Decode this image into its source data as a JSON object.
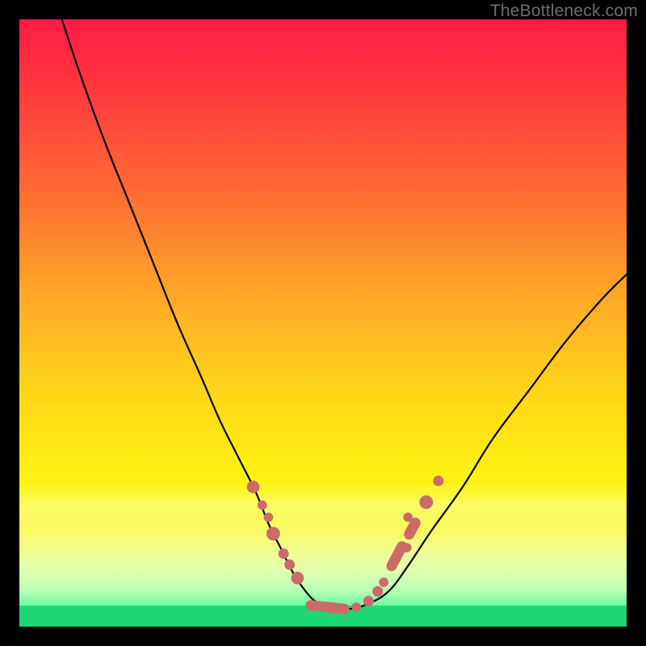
{
  "attribution": "TheBottleneck.com",
  "colors": {
    "gradient_top": "#ff1b46",
    "gradient_bottom": "#1bd873",
    "curve": "#000000",
    "marker": "#cc6a6a",
    "frame": "#000000"
  },
  "chart_data": {
    "type": "line",
    "title": "",
    "xlabel": "",
    "ylabel": "",
    "xlim": [
      0,
      100
    ],
    "ylim": [
      0,
      100
    ],
    "grid": false,
    "legend": false,
    "series": [
      {
        "name": "bottleneck-curve",
        "x": [
          7,
          10,
          14,
          18,
          22,
          26,
          30,
          33,
          36,
          39,
          41,
          43,
          45,
          47,
          49,
          52,
          55,
          58,
          61,
          64,
          68,
          73,
          78,
          84,
          90,
          96,
          100
        ],
        "y": [
          100,
          91,
          80,
          70,
          60,
          50,
          41,
          34,
          28,
          22,
          17,
          13,
          9,
          6,
          4,
          3,
          3,
          4,
          6,
          10,
          16,
          23,
          31,
          39,
          47,
          54,
          58
        ]
      }
    ],
    "markers": [
      {
        "x": 38.5,
        "y": 23.0,
        "r": 1.2
      },
      {
        "x": 40.0,
        "y": 20.0,
        "r": 0.9
      },
      {
        "x": 41.0,
        "y": 18.0,
        "r": 0.9
      },
      {
        "x": 41.8,
        "y": 15.3,
        "r": 1.3
      },
      {
        "x": 43.5,
        "y": 12.0,
        "r": 1.0
      },
      {
        "x": 44.5,
        "y": 10.2,
        "r": 1.0
      },
      {
        "x": 45.8,
        "y": 8.0,
        "r": 1.2
      },
      {
        "x": 55.5,
        "y": 3.2,
        "r": 0.9
      },
      {
        "x": 57.5,
        "y": 4.2,
        "r": 1.0
      },
      {
        "x": 59.0,
        "y": 5.8,
        "r": 1.0
      },
      {
        "x": 60.0,
        "y": 7.3,
        "r": 0.9
      },
      {
        "x": 63.8,
        "y": 13.0,
        "r": 0.9
      },
      {
        "x": 64.0,
        "y": 18.0,
        "r": 0.9
      },
      {
        "x": 67.0,
        "y": 20.5,
        "r": 1.3
      },
      {
        "x": 69.0,
        "y": 24.0,
        "r": 1.0
      }
    ],
    "marker_segments": [
      {
        "x1": 48.0,
        "y1": 3.5,
        "x2": 53.5,
        "y2": 2.9
      },
      {
        "x1": 61.3,
        "y1": 10.0,
        "x2": 63.0,
        "y2": 13.2
      },
      {
        "x1": 64.2,
        "y1": 15.2,
        "x2": 65.2,
        "y2": 17.1
      }
    ]
  }
}
